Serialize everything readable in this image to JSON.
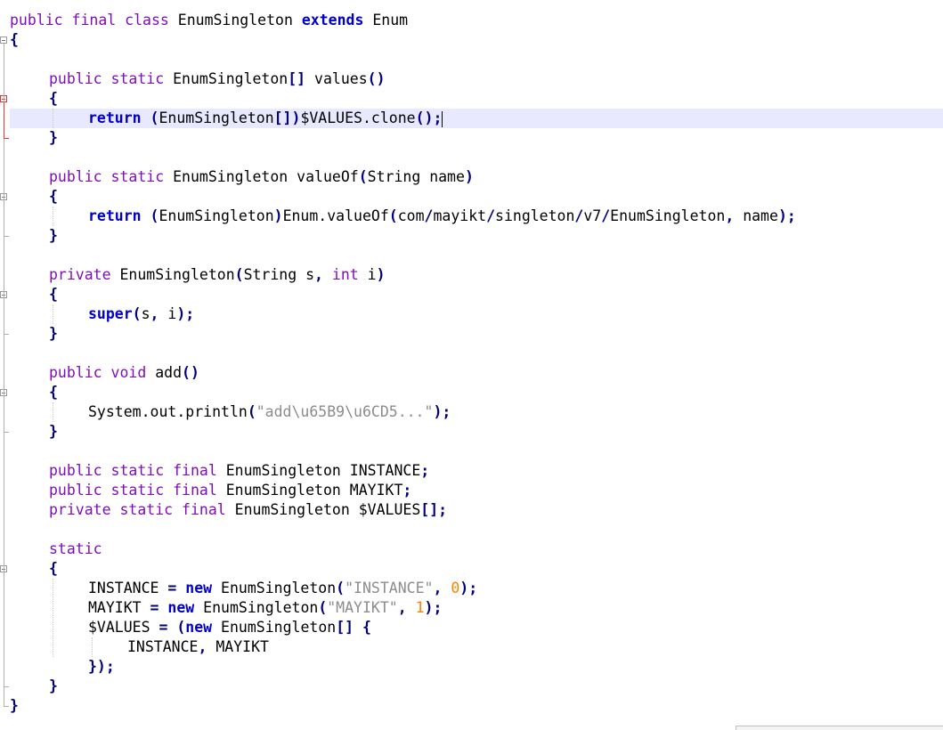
{
  "editor": {
    "lines": [
      {
        "indent": 0,
        "tokens": [
          {
            "t": "public ",
            "c": "kw"
          },
          {
            "t": "final ",
            "c": "kw"
          },
          {
            "t": "class ",
            "c": "kw"
          },
          {
            "t": "EnumSingleton ",
            "c": "txt"
          },
          {
            "t": "extends ",
            "c": "kwb"
          },
          {
            "t": "Enum",
            "c": "txt"
          }
        ]
      },
      {
        "indent": 0,
        "tokens": [
          {
            "t": "{",
            "c": "op"
          }
        ]
      },
      {
        "indent": 0,
        "tokens": []
      },
      {
        "indent": 1,
        "tokens": [
          {
            "t": "public ",
            "c": "kw"
          },
          {
            "t": "static ",
            "c": "kw"
          },
          {
            "t": "EnumSingleton",
            "c": "txt"
          },
          {
            "t": "[] ",
            "c": "op"
          },
          {
            "t": "values",
            "c": "txt"
          },
          {
            "t": "()",
            "c": "op"
          }
        ]
      },
      {
        "indent": 1,
        "tokens": [
          {
            "t": "{",
            "c": "op"
          }
        ]
      },
      {
        "indent": 2,
        "current": true,
        "tokens": [
          {
            "t": "return ",
            "c": "kwb"
          },
          {
            "t": "(",
            "c": "op"
          },
          {
            "t": "EnumSingleton",
            "c": "txt"
          },
          {
            "t": "[])",
            "c": "op"
          },
          {
            "t": "$VALUES.clone",
            "c": "txt"
          },
          {
            "t": "();",
            "c": "op"
          }
        ]
      },
      {
        "indent": 1,
        "tokens": [
          {
            "t": "}",
            "c": "op"
          }
        ]
      },
      {
        "indent": 0,
        "tokens": []
      },
      {
        "indent": 1,
        "tokens": [
          {
            "t": "public ",
            "c": "kw"
          },
          {
            "t": "static ",
            "c": "kw"
          },
          {
            "t": "EnumSingleton valueOf",
            "c": "txt"
          },
          {
            "t": "(",
            "c": "op"
          },
          {
            "t": "String name",
            "c": "txt"
          },
          {
            "t": ")",
            "c": "op"
          }
        ]
      },
      {
        "indent": 1,
        "tokens": [
          {
            "t": "{",
            "c": "op"
          }
        ]
      },
      {
        "indent": 2,
        "tokens": [
          {
            "t": "return ",
            "c": "kwb"
          },
          {
            "t": "(",
            "c": "op"
          },
          {
            "t": "EnumSingleton",
            "c": "txt"
          },
          {
            "t": ")",
            "c": "op"
          },
          {
            "t": "Enum.valueOf",
            "c": "txt"
          },
          {
            "t": "(",
            "c": "op"
          },
          {
            "t": "com",
            "c": "txt"
          },
          {
            "t": "/",
            "c": "op"
          },
          {
            "t": "mayikt",
            "c": "txt"
          },
          {
            "t": "/",
            "c": "op"
          },
          {
            "t": "singleton",
            "c": "txt"
          },
          {
            "t": "/",
            "c": "op"
          },
          {
            "t": "v7",
            "c": "txt"
          },
          {
            "t": "/",
            "c": "op"
          },
          {
            "t": "EnumSingleton",
            "c": "txt"
          },
          {
            "t": ", ",
            "c": "op"
          },
          {
            "t": "name",
            "c": "txt"
          },
          {
            "t": ");",
            "c": "op"
          }
        ]
      },
      {
        "indent": 1,
        "tokens": [
          {
            "t": "}",
            "c": "op"
          }
        ]
      },
      {
        "indent": 0,
        "tokens": []
      },
      {
        "indent": 1,
        "tokens": [
          {
            "t": "private ",
            "c": "kw"
          },
          {
            "t": "EnumSingleton",
            "c": "txt"
          },
          {
            "t": "(",
            "c": "op"
          },
          {
            "t": "String s",
            "c": "txt"
          },
          {
            "t": ", ",
            "c": "op"
          },
          {
            "t": "int ",
            "c": "kw"
          },
          {
            "t": "i",
            "c": "txt"
          },
          {
            "t": ")",
            "c": "op"
          }
        ]
      },
      {
        "indent": 1,
        "tokens": [
          {
            "t": "{",
            "c": "op"
          }
        ]
      },
      {
        "indent": 2,
        "tokens": [
          {
            "t": "super",
            "c": "kwb"
          },
          {
            "t": "(",
            "c": "op"
          },
          {
            "t": "s",
            "c": "txt"
          },
          {
            "t": ", ",
            "c": "op"
          },
          {
            "t": "i",
            "c": "txt"
          },
          {
            "t": ");",
            "c": "op"
          }
        ]
      },
      {
        "indent": 1,
        "tokens": [
          {
            "t": "}",
            "c": "op"
          }
        ]
      },
      {
        "indent": 0,
        "tokens": []
      },
      {
        "indent": 1,
        "tokens": [
          {
            "t": "public ",
            "c": "kw"
          },
          {
            "t": "void ",
            "c": "kw"
          },
          {
            "t": "add",
            "c": "txt"
          },
          {
            "t": "()",
            "c": "op"
          }
        ]
      },
      {
        "indent": 1,
        "tokens": [
          {
            "t": "{",
            "c": "op"
          }
        ]
      },
      {
        "indent": 2,
        "tokens": [
          {
            "t": "System.out.println",
            "c": "txt"
          },
          {
            "t": "(",
            "c": "op"
          },
          {
            "t": "\"add\\u65B9\\u6CD5...\"",
            "c": "str"
          },
          {
            "t": ");",
            "c": "op"
          }
        ]
      },
      {
        "indent": 1,
        "tokens": [
          {
            "t": "}",
            "c": "op"
          }
        ]
      },
      {
        "indent": 0,
        "tokens": []
      },
      {
        "indent": 1,
        "tokens": [
          {
            "t": "public ",
            "c": "kw"
          },
          {
            "t": "static ",
            "c": "kw"
          },
          {
            "t": "final ",
            "c": "kw"
          },
          {
            "t": "EnumSingleton INSTANCE",
            "c": "txt"
          },
          {
            "t": ";",
            "c": "op"
          }
        ]
      },
      {
        "indent": 1,
        "tokens": [
          {
            "t": "public ",
            "c": "kw"
          },
          {
            "t": "static ",
            "c": "kw"
          },
          {
            "t": "final ",
            "c": "kw"
          },
          {
            "t": "EnumSingleton MAYIKT",
            "c": "txt"
          },
          {
            "t": ";",
            "c": "op"
          }
        ]
      },
      {
        "indent": 1,
        "tokens": [
          {
            "t": "private ",
            "c": "kw"
          },
          {
            "t": "static ",
            "c": "kw"
          },
          {
            "t": "final ",
            "c": "kw"
          },
          {
            "t": "EnumSingleton $VALUES",
            "c": "txt"
          },
          {
            "t": "[];",
            "c": "op"
          }
        ]
      },
      {
        "indent": 0,
        "tokens": []
      },
      {
        "indent": 1,
        "tokens": [
          {
            "t": "static",
            "c": "kw"
          }
        ]
      },
      {
        "indent": 1,
        "tokens": [
          {
            "t": "{",
            "c": "op"
          }
        ]
      },
      {
        "indent": 2,
        "tokens": [
          {
            "t": "INSTANCE ",
            "c": "txt"
          },
          {
            "t": "= ",
            "c": "op"
          },
          {
            "t": "new ",
            "c": "kwb"
          },
          {
            "t": "EnumSingleton",
            "c": "txt"
          },
          {
            "t": "(",
            "c": "op"
          },
          {
            "t": "\"INSTANCE\"",
            "c": "str"
          },
          {
            "t": ", ",
            "c": "op"
          },
          {
            "t": "0",
            "c": "num"
          },
          {
            "t": ");",
            "c": "op"
          }
        ]
      },
      {
        "indent": 2,
        "tokens": [
          {
            "t": "MAYIKT ",
            "c": "txt"
          },
          {
            "t": "= ",
            "c": "op"
          },
          {
            "t": "new ",
            "c": "kwb"
          },
          {
            "t": "EnumSingleton",
            "c": "txt"
          },
          {
            "t": "(",
            "c": "op"
          },
          {
            "t": "\"MAYIKT\"",
            "c": "str"
          },
          {
            "t": ", ",
            "c": "op"
          },
          {
            "t": "1",
            "c": "num"
          },
          {
            "t": ");",
            "c": "op"
          }
        ]
      },
      {
        "indent": 2,
        "tokens": [
          {
            "t": "$VALUES ",
            "c": "txt"
          },
          {
            "t": "= (",
            "c": "op"
          },
          {
            "t": "new ",
            "c": "kwb"
          },
          {
            "t": "EnumSingleton",
            "c": "txt"
          },
          {
            "t": "[] {",
            "c": "op"
          }
        ]
      },
      {
        "indent": 3,
        "tokens": [
          {
            "t": "INSTANCE",
            "c": "txt"
          },
          {
            "t": ", ",
            "c": "op"
          },
          {
            "t": "MAYIKT",
            "c": "txt"
          }
        ]
      },
      {
        "indent": 2,
        "tokens": [
          {
            "t": "});",
            "c": "op"
          }
        ]
      },
      {
        "indent": 1,
        "tokens": [
          {
            "t": "}",
            "c": "op"
          }
        ]
      },
      {
        "indent": 0,
        "tokens": [
          {
            "t": "}",
            "c": "op"
          }
        ]
      }
    ]
  },
  "colors": {
    "modifier": "#7f0eb8",
    "keyword_bold": "#0000c8",
    "operator": "#000080",
    "string": "#8c8c8c",
    "number": "#ff8000",
    "current_line": "#e8e8ff",
    "fold_marker_active": "#e03a3a"
  }
}
